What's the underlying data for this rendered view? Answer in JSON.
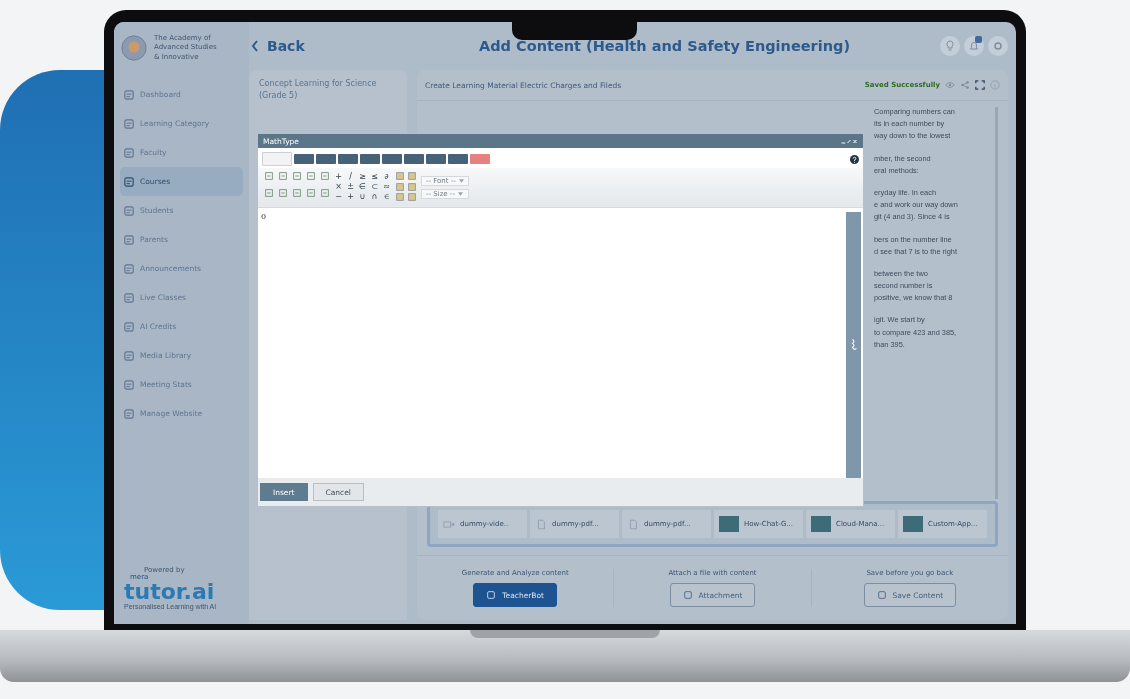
{
  "logo": {
    "lines": [
      "The Academy of",
      "Advanced Studies",
      "& Innovative"
    ]
  },
  "sidebar": {
    "items": [
      {
        "label": "Dashboard",
        "selected": false
      },
      {
        "label": "Learning Category",
        "selected": false
      },
      {
        "label": "Faculty",
        "selected": false
      },
      {
        "label": "Courses",
        "selected": true
      },
      {
        "label": "Students",
        "selected": false
      },
      {
        "label": "Parents",
        "selected": false
      },
      {
        "label": "Announcements",
        "selected": false
      },
      {
        "label": "Live Classes",
        "selected": false
      },
      {
        "label": "AI Credits",
        "selected": false
      },
      {
        "label": "Media Library",
        "selected": false
      },
      {
        "label": "Meeting Stats",
        "selected": false
      },
      {
        "label": "Manage Website",
        "selected": false
      }
    ]
  },
  "powered": {
    "caption": "Powered by",
    "brand_prefix": "mera",
    "brand": "tutor.ai",
    "tagline": "Personalised Learning with AI"
  },
  "header": {
    "back": "Back",
    "title": "Add Content (Health and Safety Engineering)"
  },
  "course_panel": {
    "title": "Concept Learning for Science (Grade 5)"
  },
  "editor_panel": {
    "title": "Create Learning Material Electric Charges and Fileds",
    "status": "Saved Successfully",
    "body_paragraphs": [
      [
        "Comparing numbers can",
        "its in each number by",
        "way down to the lowest"
      ],
      [
        "mber, the second",
        "eral methods:"
      ],
      [
        "eryday life. In each",
        "e and work our way down",
        "git (4 and 3). Since 4 is"
      ],
      [
        "bers on the number line",
        "d see that 7 is to the right"
      ],
      [
        "between the two",
        "second number is",
        "positive, we know that 8"
      ],
      [
        "igit. We start by",
        "to compare 423 and 385,",
        "than 395."
      ]
    ],
    "attachments": [
      {
        "kind": "video",
        "name": "dummy-vide.."
      },
      {
        "kind": "pdf",
        "name": "dummy-pdf..."
      },
      {
        "kind": "pdf",
        "name": "dummy-pdf..."
      },
      {
        "kind": "image",
        "name": "How-Chat-G..."
      },
      {
        "kind": "image",
        "name": "Cloud-Mana..."
      },
      {
        "kind": "image",
        "name": "Custom-App..."
      }
    ]
  },
  "actions": [
    {
      "kind": "primary",
      "hint": "Generate and Analyze content",
      "label": "TeacherBot"
    },
    {
      "kind": "attach",
      "hint": "Attach a file with content",
      "label": "Attachment"
    },
    {
      "kind": "save",
      "hint": "Save before you go back",
      "label": "Save Content"
    }
  ],
  "mathtype": {
    "title": "MathType",
    "tabs": [
      {
        "kind": "normal",
        "selected": true
      },
      {
        "kind": "normal",
        "selected": false
      },
      {
        "kind": "normal",
        "selected": false
      },
      {
        "kind": "normal",
        "selected": false
      },
      {
        "kind": "normal",
        "selected": false
      },
      {
        "kind": "normal",
        "selected": false
      },
      {
        "kind": "normal",
        "selected": false
      },
      {
        "kind": "normal",
        "selected": false
      },
      {
        "kind": "normal",
        "selected": false
      },
      {
        "kind": "special",
        "selected": false
      }
    ],
    "symbol_rows": [
      [
        "+",
        "/",
        "≥",
        "≤",
        "∂"
      ],
      [
        "×",
        "±",
        "∈",
        "⊂",
        "≈"
      ],
      [
        "−",
        "+",
        "∪",
        "∩",
        "∊"
      ]
    ],
    "font_select": "-- Font --",
    "size_select": "-- Size --",
    "value": "0",
    "buttons": [
      {
        "kind": "primary",
        "label": "Insert"
      },
      {
        "kind": "plain",
        "label": "Cancel"
      }
    ]
  }
}
